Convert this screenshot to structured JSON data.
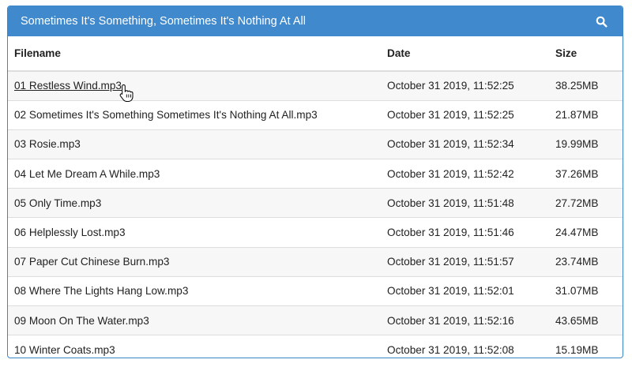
{
  "panel": {
    "title": "Sometimes It's Something, Sometimes It's Nothing At All",
    "search_icon": "search-icon"
  },
  "table": {
    "headers": {
      "filename": "Filename",
      "date": "Date",
      "size": "Size"
    },
    "rows": [
      {
        "filename": "01 Restless Wind.mp3",
        "date": "October 31 2019, 11:52:25",
        "size": "38.25MB"
      },
      {
        "filename": "02 Sometimes It's Something Sometimes It's Nothing At All.mp3",
        "date": "October 31 2019, 11:52:25",
        "size": "21.87MB"
      },
      {
        "filename": "03 Rosie.mp3",
        "date": "October 31 2019, 11:52:34",
        "size": "19.99MB"
      },
      {
        "filename": "04 Let Me Dream A While.mp3",
        "date": "October 31 2019, 11:52:42",
        "size": "37.26MB"
      },
      {
        "filename": "05 Only Time.mp3",
        "date": "October 31 2019, 11:51:48",
        "size": "27.72MB"
      },
      {
        "filename": "06 Helplessly Lost.mp3",
        "date": "October 31 2019, 11:51:46",
        "size": "24.47MB"
      },
      {
        "filename": "07 Paper Cut Chinese Burn.mp3",
        "date": "October 31 2019, 11:51:57",
        "size": "23.74MB"
      },
      {
        "filename": "08 Where The Lights Hang Low.mp3",
        "date": "October 31 2019, 11:52:01",
        "size": "31.07MB"
      },
      {
        "filename": "09 Moon On The Water.mp3",
        "date": "October 31 2019, 11:52:16",
        "size": "43.65MB"
      },
      {
        "filename": "10 Winter Coats.mp3",
        "date": "October 31 2019, 11:52:08",
        "size": "15.19MB"
      }
    ]
  },
  "colors": {
    "header_bg": "#3f89cc",
    "stripe": "#f7f7f7"
  }
}
